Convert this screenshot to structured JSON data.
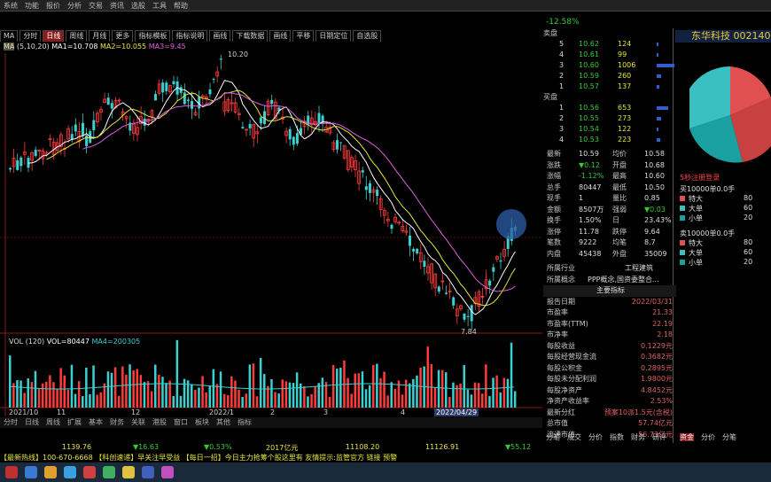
{
  "menubar": [
    "系统",
    "功能",
    "报价",
    "分析",
    "交易",
    "资讯",
    "选股",
    "工具",
    "帮助"
  ],
  "toolbar": {
    "tabs": [
      "MA",
      "分时",
      "日线",
      "周线",
      "月线",
      "更多"
    ],
    "active_tab": "日线",
    "options": [
      "指标模板",
      "指标说明",
      "画线",
      "下载数据",
      "画线",
      "平移",
      "日期定位",
      "自选股"
    ]
  },
  "main_chart": {
    "ma_label": "MA",
    "ma_params": "(5,10,20)",
    "ma1": "MA1=10.708",
    "ma2": "MA2=10.055",
    "ma3": "MA3=9.45",
    "high_label": "10.20",
    "low_label": "7.84",
    "date_label": "2022/04/29",
    "axis_dates": [
      "2021/10",
      "11",
      "12",
      "2022/1",
      "2",
      "3",
      "4"
    ]
  },
  "volume_chart": {
    "label": "VOL",
    "params": "(120)",
    "vol": "VOL=80447",
    "ma4": "MA4=200305"
  },
  "bottom_tabs": [
    "分时",
    "日线",
    "周线",
    "扩展",
    "基本",
    "财务",
    "关联",
    "港股",
    "窗口",
    "板块",
    "其他",
    "指标"
  ],
  "stock": {
    "title": "东华科技",
    "code": "002140",
    "pct": "-12.58%",
    "asks": [
      {
        "label": "5",
        "price": "10.62",
        "vol": "124"
      },
      {
        "label": "4",
        "price": "10.61",
        "vol": "99"
      },
      {
        "label": "3",
        "price": "10.60",
        "vol": "1006"
      },
      {
        "label": "2",
        "price": "10.59",
        "vol": "260"
      },
      {
        "label": "1",
        "price": "10.57",
        "vol": "137"
      }
    ],
    "bids": [
      {
        "label": "1",
        "price": "10.56",
        "vol": "653"
      },
      {
        "label": "2",
        "price": "10.55",
        "vol": "273"
      },
      {
        "label": "3",
        "price": "10.54",
        "vol": "122"
      },
      {
        "label": "4",
        "price": "10.53",
        "vol": "223"
      }
    ],
    "ask_side": "卖盘",
    "bid_side": "买盘",
    "stats": [
      {
        "k1": "最新",
        "v1": "10.59",
        "k2": "均价",
        "v2": "10.58"
      },
      {
        "k1": "涨跌",
        "v1": "▼0.12",
        "k2": "开盘",
        "v2": "10.68"
      },
      {
        "k1": "涨幅",
        "v1": "-1.12%",
        "k2": "最高",
        "v2": "10.60"
      },
      {
        "k1": "总手",
        "v1": "80447",
        "k2": "最低",
        "v2": "10.50"
      },
      {
        "k1": "现手",
        "v1": "1",
        "k2": "量比",
        "v2": "0.85"
      },
      {
        "k1": "金额",
        "v1": "8507万",
        "k2": "强弱",
        "v2": "▼0.03"
      },
      {
        "k1": "换手",
        "v1": "1.50%",
        "k2": "日",
        "v2": "23.43%"
      },
      {
        "k1": "涨停",
        "v1": "11.78",
        "k2": "跌停",
        "v2": "9.64"
      },
      {
        "k1": "笔数",
        "v1": "9222",
        "k2": "均笔",
        "v2": "8.7"
      },
      {
        "k1": "内盘",
        "v1": "45438",
        "k2": "外盘",
        "v2": "35009"
      }
    ],
    "industry_label": "所属行业",
    "industry": "工程建筑",
    "concept_label": "所属概念",
    "concept": "PPP概念,国资委整合...",
    "section_title": "主要指标",
    "fundamentals": [
      {
        "k": "报告日期",
        "v": "2022/03/31"
      },
      {
        "k": "市盈率",
        "v": "21.33"
      },
      {
        "k": "市盈率(TTM)",
        "v": "22.19"
      },
      {
        "k": "市净率",
        "v": "2.18"
      },
      {
        "k": "每股收益",
        "v": "0.1229元"
      },
      {
        "k": "每股经营现金流",
        "v": "0.3682元"
      },
      {
        "k": "每股公积金",
        "v": "0.2895元"
      },
      {
        "k": "每股未分配利润",
        "v": "1.9800元"
      },
      {
        "k": "每股净资产",
        "v": "4.8452元"
      },
      {
        "k": "净资产收益率",
        "v": "2.53%"
      },
      {
        "k": "最新分红",
        "v": "预案10派1.5元(含税)"
      },
      {
        "k": "总市值",
        "v": "57.74亿元"
      },
      {
        "k": "流通市值",
        "v": "56.73亿元"
      }
    ],
    "right_tabs": [
      "分笔",
      "成交",
      "分价",
      "指数",
      "财务",
      "研评"
    ]
  },
  "pie": {
    "title": "5秒注册登录",
    "group1_title": "买10000单0.0手",
    "group1": [
      {
        "k": "特大",
        "v": "80"
      },
      {
        "k": "大单",
        "v": "60"
      },
      {
        "k": "小单",
        "v": "20"
      }
    ],
    "group2_title": "卖10000单0.0手",
    "group2": [
      {
        "k": "特大",
        "v": "80"
      },
      {
        "k": "大单",
        "v": "60"
      },
      {
        "k": "小单",
        "v": "20"
      }
    ],
    "tabs": [
      "资金",
      "分价",
      "分笔"
    ],
    "colors": [
      "#e05050",
      "#3ac0c0",
      "#1aa0a0",
      "#c84040"
    ]
  },
  "status": {
    "items": [
      "1139.76",
      "▼16.63",
      "▼0.53%",
      "2017亿元",
      "11108.20",
      "11126.91",
      "▼55.12"
    ],
    "ticker": "【最新热线】100-670-6668  【科创速递】早关注早受益  【每日一招】今日主力抢筹个股这里有  友情提示:监管官方  链接 预警"
  },
  "colors": {
    "up": "#ff3b3b",
    "down": "#3bd0d0",
    "ma5": "#ffffff",
    "ma10": "#e6e63c",
    "ma20": "#e060e0"
  }
}
